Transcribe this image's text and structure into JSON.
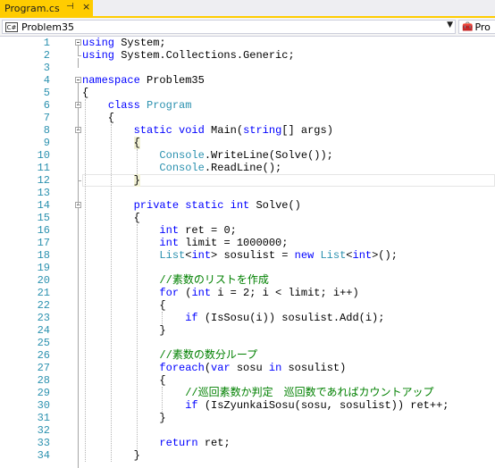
{
  "tab": {
    "title": "Program.cs",
    "pin": "⊣",
    "close": "×"
  },
  "nav": {
    "left_label": "Problem35",
    "left_icon": "C#",
    "dropdown_icon": "▼",
    "right_label": "Pro"
  },
  "editor": {
    "lines": [
      {
        "n": "1"
      },
      {
        "n": "2"
      },
      {
        "n": "3"
      },
      {
        "n": "4"
      },
      {
        "n": "5"
      },
      {
        "n": "6"
      },
      {
        "n": "7"
      },
      {
        "n": "8"
      },
      {
        "n": "9"
      },
      {
        "n": "10"
      },
      {
        "n": "11"
      },
      {
        "n": "12"
      },
      {
        "n": "13"
      },
      {
        "n": "14"
      },
      {
        "n": "15"
      },
      {
        "n": "16"
      },
      {
        "n": "17"
      },
      {
        "n": "18"
      },
      {
        "n": "19"
      },
      {
        "n": "20"
      },
      {
        "n": "21"
      },
      {
        "n": "22"
      },
      {
        "n": "23"
      },
      {
        "n": "24"
      },
      {
        "n": "25"
      },
      {
        "n": "26"
      },
      {
        "n": "27"
      },
      {
        "n": "28"
      },
      {
        "n": "29"
      },
      {
        "n": "30"
      },
      {
        "n": "31"
      },
      {
        "n": "32"
      },
      {
        "n": "33"
      },
      {
        "n": "34"
      }
    ],
    "code": [
      [
        [
          "kw",
          "using"
        ],
        [
          "t",
          " System;"
        ]
      ],
      [
        [
          "kw",
          "using"
        ],
        [
          "t",
          " System.Collections.Generic;"
        ]
      ],
      [],
      [
        [
          "kw",
          "namespace"
        ],
        [
          "t",
          " Problem35"
        ]
      ],
      [
        [
          "t",
          "{"
        ]
      ],
      [
        [
          "t",
          "    "
        ],
        [
          "kw",
          "class"
        ],
        [
          "t",
          " "
        ],
        [
          "ty",
          "Program"
        ]
      ],
      [
        [
          "t",
          "    {"
        ]
      ],
      [
        [
          "t",
          "        "
        ],
        [
          "kw",
          "static"
        ],
        [
          "t",
          " "
        ],
        [
          "kw",
          "void"
        ],
        [
          "t",
          " Main("
        ],
        [
          "kw",
          "string"
        ],
        [
          "t",
          "[] args)"
        ]
      ],
      [
        [
          "t",
          "        "
        ],
        [
          "hl",
          "{"
        ]
      ],
      [
        [
          "t",
          "            "
        ],
        [
          "ty",
          "Console"
        ],
        [
          "t",
          ".WriteLine(Solve());"
        ]
      ],
      [
        [
          "t",
          "            "
        ],
        [
          "ty",
          "Console"
        ],
        [
          "t",
          ".ReadLine();"
        ]
      ],
      [
        [
          "t",
          "        "
        ],
        [
          "hl",
          "}"
        ]
      ],
      [],
      [
        [
          "t",
          "        "
        ],
        [
          "kw",
          "private"
        ],
        [
          "t",
          " "
        ],
        [
          "kw",
          "static"
        ],
        [
          "t",
          " "
        ],
        [
          "kw",
          "int"
        ],
        [
          "t",
          " Solve()"
        ]
      ],
      [
        [
          "t",
          "        {"
        ]
      ],
      [
        [
          "t",
          "            "
        ],
        [
          "kw",
          "int"
        ],
        [
          "t",
          " ret = 0;"
        ]
      ],
      [
        [
          "t",
          "            "
        ],
        [
          "kw",
          "int"
        ],
        [
          "t",
          " limit = 1000000;"
        ]
      ],
      [
        [
          "t",
          "            "
        ],
        [
          "ty",
          "List"
        ],
        [
          "t",
          "<"
        ],
        [
          "kw",
          "int"
        ],
        [
          "t",
          "> sosulist = "
        ],
        [
          "kw",
          "new"
        ],
        [
          "t",
          " "
        ],
        [
          "ty",
          "List"
        ],
        [
          "t",
          "<"
        ],
        [
          "kw",
          "int"
        ],
        [
          "t",
          ">();"
        ]
      ],
      [],
      [
        [
          "t",
          "            "
        ],
        [
          "com",
          "//素数のリストを作成"
        ]
      ],
      [
        [
          "t",
          "            "
        ],
        [
          "kw",
          "for"
        ],
        [
          "t",
          " ("
        ],
        [
          "kw",
          "int"
        ],
        [
          "t",
          " i = 2; i < limit; i++)"
        ]
      ],
      [
        [
          "t",
          "            {"
        ]
      ],
      [
        [
          "t",
          "                "
        ],
        [
          "kw",
          "if"
        ],
        [
          "t",
          " (IsSosu(i)) sosulist.Add(i);"
        ]
      ],
      [
        [
          "t",
          "            }"
        ]
      ],
      [],
      [
        [
          "t",
          "            "
        ],
        [
          "com",
          "//素数の数分ループ"
        ]
      ],
      [
        [
          "t",
          "            "
        ],
        [
          "kw",
          "foreach"
        ],
        [
          "t",
          "("
        ],
        [
          "kw",
          "var"
        ],
        [
          "t",
          " sosu "
        ],
        [
          "kw",
          "in"
        ],
        [
          "t",
          " sosulist)"
        ]
      ],
      [
        [
          "t",
          "            {"
        ]
      ],
      [
        [
          "t",
          "                "
        ],
        [
          "com",
          "//巡回素数か判定　巡回数であればカウントアップ"
        ]
      ],
      [
        [
          "t",
          "                "
        ],
        [
          "kw",
          "if"
        ],
        [
          "t",
          " (IsZyunkaiSosu(sosu, sosulist)) ret++;"
        ]
      ],
      [
        [
          "t",
          "            }"
        ]
      ],
      [],
      [
        [
          "t",
          "            "
        ],
        [
          "kw",
          "return"
        ],
        [
          "t",
          " ret;"
        ]
      ],
      [
        [
          "t",
          "        }"
        ]
      ]
    ]
  },
  "colors": {
    "accent": "#ffcc00",
    "line_number": "#2b91af",
    "keyword": "#0000ff",
    "type": "#2b91af",
    "comment": "#008000",
    "changed": "#57a64a"
  }
}
